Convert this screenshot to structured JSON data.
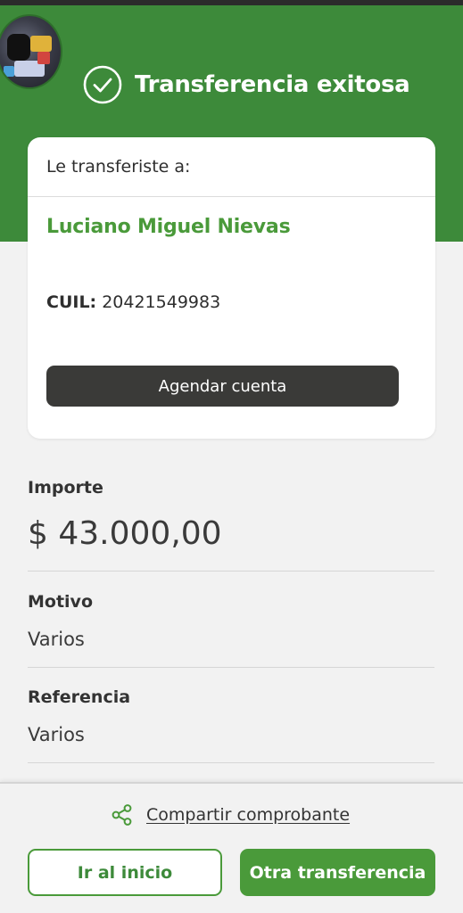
{
  "header": {
    "title": "Transferencia exitosa",
    "status_icon": "check-circle-icon",
    "background_color": "#3d8a3a"
  },
  "recipient_card": {
    "heading": "Le transferiste a:",
    "name": "Luciano Miguel Nievas",
    "cuil_label": "CUIL:",
    "cuil_value": "20421549983",
    "schedule_button_label": "Agendar cuenta"
  },
  "details": {
    "amount_label": "Importe",
    "amount_value": "$ 43.000,00",
    "reason_label": "Motivo",
    "reason_value": "Varios",
    "reference_label": "Referencia",
    "reference_value": "Varios"
  },
  "footer": {
    "share_icon": "share-icon",
    "share_label": "Compartir comprobante",
    "home_button_label": "Ir al inicio",
    "new_transfer_button_label": "Otra transferencia"
  },
  "colors": {
    "brand_green": "#4a9a3a",
    "dark_button": "#3a3a38"
  }
}
